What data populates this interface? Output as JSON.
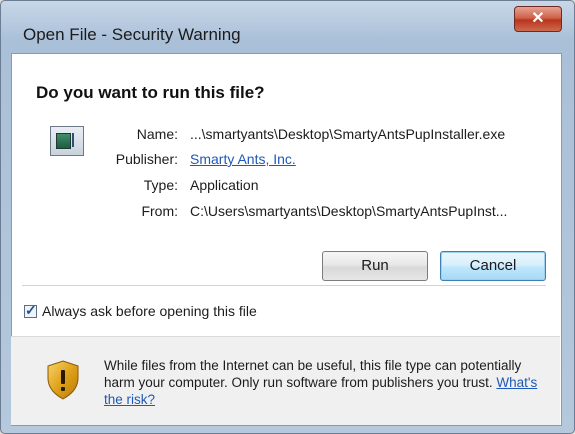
{
  "window": {
    "title": "Open File - Security Warning",
    "close_label": "✕"
  },
  "dialog": {
    "heading": "Do you want to run this file?",
    "fields": {
      "name_label": "Name:",
      "name_value": "...\\smartyants\\Desktop\\SmartyAntsPupInstaller.exe",
      "publisher_label": "Publisher:",
      "publisher_value": "Smarty Ants, Inc.",
      "type_label": "Type:",
      "type_value": "Application",
      "from_label": "From:",
      "from_value": "C:\\Users\\smartyants\\Desktop\\SmartyAntsPupInst..."
    },
    "buttons": {
      "run": "Run",
      "cancel": "Cancel"
    },
    "checkbox": {
      "label": "Always ask before opening this file",
      "checked": true,
      "mark": "✓"
    },
    "warning": {
      "text": "While files from the Internet can be useful, this file type can potentially harm your computer. Only run software from publishers you trust.",
      "link": "What's the risk?"
    }
  },
  "icons": {
    "file": "application-file-icon",
    "warning": "shield-warning-icon"
  },
  "colors": {
    "link": "#1f58b8",
    "close_button": "#c0452e",
    "shield": "#e0a21a"
  }
}
